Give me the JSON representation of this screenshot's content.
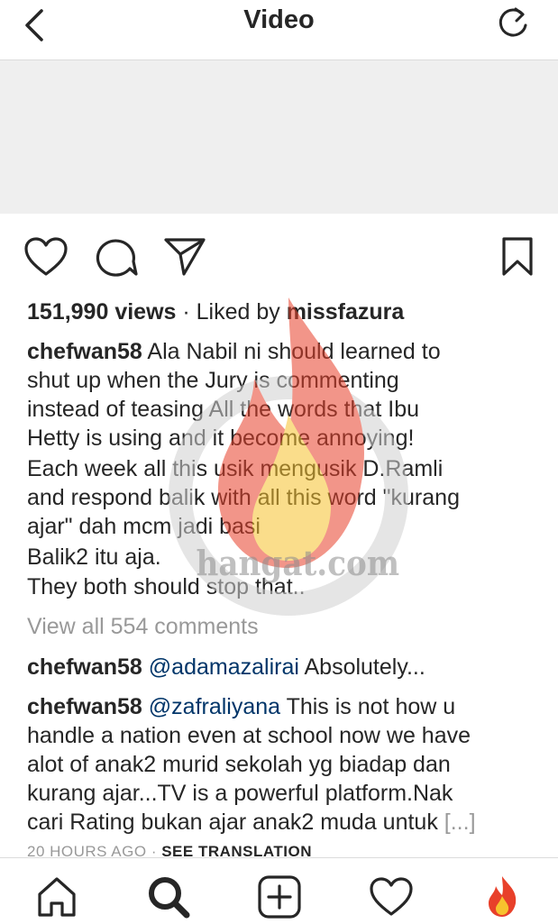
{
  "header": {
    "title": "Video"
  },
  "post": {
    "views": "151,990 views",
    "liked_by_prefix": " · Liked by ",
    "liked_by_user": "missfazura",
    "caption_user": "chefwan58",
    "caption_lines": [
      "Ala Nabil ni should learned to",
      "shut up when the Jury is commenting",
      "instead of teasing All the words that Ibu",
      "Hetty is using and it become annoying!",
      "Each week all this usik mengusik D.Ramli",
      "and respond balik with all this word \"kurang",
      "ajar\" dah mcm jadi basi",
      "Balik2 itu aja.",
      "They both should stop that.."
    ],
    "view_all_comments": "View all 554 comments",
    "comments": [
      {
        "user": "chefwan58",
        "mention": "@adamazalirai",
        "text": " Absolutely..."
      },
      {
        "user": "chefwan58",
        "mention": "@zafraliyana",
        "text_first": " This is not how u",
        "text_lines": [
          "handle a nation even at school now we have",
          "alot of anak2 murid sekolah yg biadap dan",
          "kurang ajar...TV is a powerful platform.Nak"
        ],
        "text_last": "cari Rating bukan ajar anak2 muda untuk ",
        "more": "[...]"
      }
    ],
    "time_ago": "20 HOURS AGO",
    "separator": " · ",
    "see_translation": "SEE TRANSLATION"
  },
  "watermark": {
    "text": "hangat.com"
  },
  "icons": {
    "back": "chevron-left-icon",
    "refresh": "refresh-icon",
    "like": "heart-icon",
    "comment": "comment-icon",
    "share": "send-icon",
    "save": "bookmark-icon",
    "tabs": [
      "home-icon",
      "search-icon",
      "new-post-icon",
      "activity-heart-icon",
      "profile-flame-icon"
    ]
  },
  "colors": {
    "link": "#003569",
    "muted": "#999999",
    "text": "#262626",
    "flame_red": "#e8402a",
    "flame_yellow": "#f7c22e"
  }
}
